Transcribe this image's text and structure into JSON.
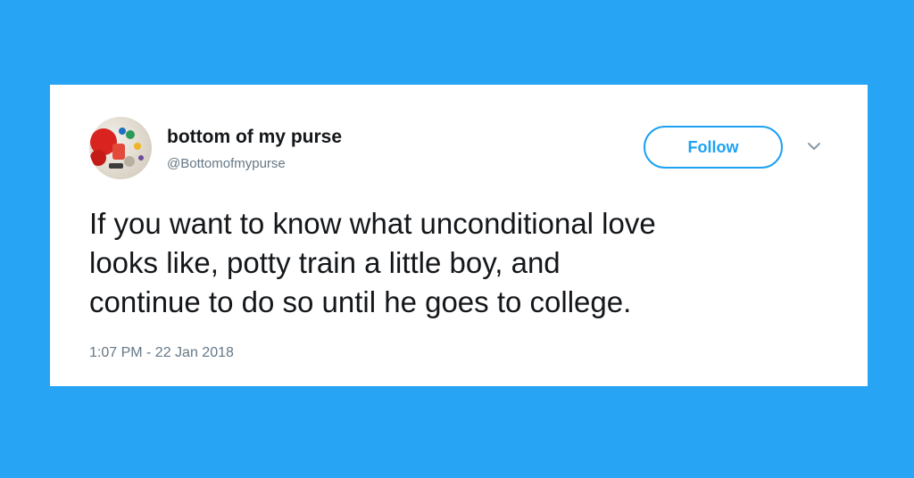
{
  "tweet": {
    "display_name": "bottom of my purse",
    "handle": "@Bottomofmypurse",
    "follow_label": "Follow",
    "text_lines": [
      "If you want to know what unconditional love",
      "looks like, potty train a little boy, and",
      "continue to do so until he goes to college."
    ],
    "timestamp": "1:07 PM - 22 Jan 2018"
  },
  "icons": {
    "avatar": "profile-photo",
    "menu": "chevron-down-icon"
  },
  "colors": {
    "background": "#27a4f3",
    "accent": "#1da1f2",
    "text": "#14171a",
    "secondary_text": "#657786"
  }
}
